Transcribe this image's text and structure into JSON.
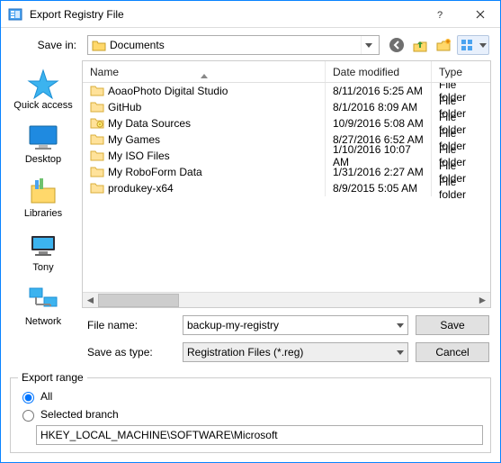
{
  "window": {
    "title": "Export Registry File"
  },
  "toolbar": {
    "save_in_label": "Save in:",
    "location": "Documents"
  },
  "places": [
    {
      "label": "Quick access"
    },
    {
      "label": "Desktop"
    },
    {
      "label": "Libraries"
    },
    {
      "label": "Tony"
    },
    {
      "label": "Network"
    }
  ],
  "columns": {
    "name": "Name",
    "date": "Date modified",
    "type": "Type"
  },
  "rows": [
    {
      "name": "AoaoPhoto Digital Studio",
      "date": "8/11/2016 5:25 AM",
      "type": "File folder",
      "special": false
    },
    {
      "name": "GitHub",
      "date": "8/1/2016 8:09 AM",
      "type": "File folder",
      "special": false
    },
    {
      "name": "My Data Sources",
      "date": "10/9/2016 5:08 AM",
      "type": "File folder",
      "special": true
    },
    {
      "name": "My Games",
      "date": "8/27/2016 6:52 AM",
      "type": "File folder",
      "special": false
    },
    {
      "name": "My ISO Files",
      "date": "1/10/2016 10:07 AM",
      "type": "File folder",
      "special": false
    },
    {
      "name": "My RoboForm Data",
      "date": "1/31/2016 2:27 AM",
      "type": "File folder",
      "special": false
    },
    {
      "name": "produkey-x64",
      "date": "8/9/2015 5:05 AM",
      "type": "File folder",
      "special": false
    }
  ],
  "fields": {
    "file_name_label": "File name:",
    "file_name_value": "backup-my-registry",
    "save_type_label": "Save as type:",
    "save_type_value": "Registration Files (*.reg)",
    "save_btn": "Save",
    "cancel_btn": "Cancel"
  },
  "export": {
    "legend": "Export range",
    "all_label": "All",
    "selected_label": "Selected branch",
    "branch_value": "HKEY_LOCAL_MACHINE\\SOFTWARE\\Microsoft",
    "selected": "all"
  }
}
